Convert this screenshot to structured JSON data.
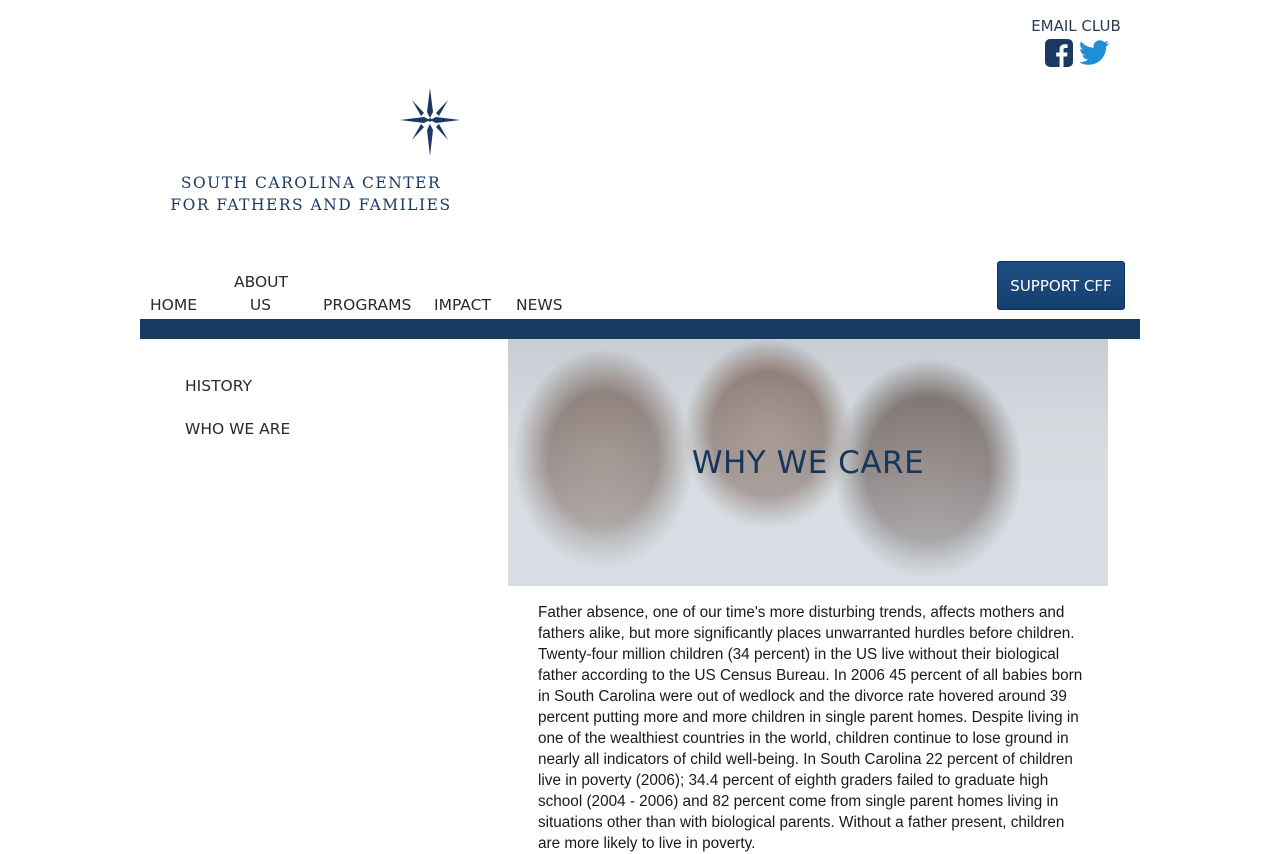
{
  "header": {
    "email_club": "EMAIL CLUB",
    "social_icons": [
      "facebook-icon",
      "twitter-icon"
    ]
  },
  "logo": {
    "line1": "SOUTH CAROLINA CENTER",
    "line2": "FOR FATHERS AND FAMILIES"
  },
  "nav": {
    "items": [
      {
        "label": "HOME"
      },
      {
        "label_line1": "ABOUT",
        "label_line2": "US"
      },
      {
        "label": "PROGRAMS"
      },
      {
        "label": "IMPACT"
      },
      {
        "label": "NEWS"
      }
    ],
    "support_label": "SUPPORT CFF"
  },
  "colors": {
    "brand_navy": "#153b63",
    "button_blue": "#1d4f86"
  },
  "sidebar": {
    "items": [
      {
        "label": "HISTORY"
      },
      {
        "label": "WHO WE ARE"
      }
    ]
  },
  "hero": {
    "title": "WHY WE CARE"
  },
  "main": {
    "paragraph": "Father absence, one of our time's more disturbing trends, affects mothers and fathers alike, but more significantly places unwarranted hurdles before children. Twenty-four million children (34 percent) in the US live without their biological father according to the US Census Bureau. In 2006 45 percent of all babies born in South Carolina were out of wedlock and the divorce rate hovered around 39 percent putting more and more children in single parent homes. Despite living in one of the wealthiest countries in the world, children continue to lose ground in nearly all indicators of child well-being. In South Carolina 22 percent of children live in poverty (2006); 34.4 percent of eighth graders failed to graduate high school (2004 - 2006) and 82 percent come from single parent homes living in situations other than with biological parents. Without a father present, children are more likely to live in poverty."
  }
}
